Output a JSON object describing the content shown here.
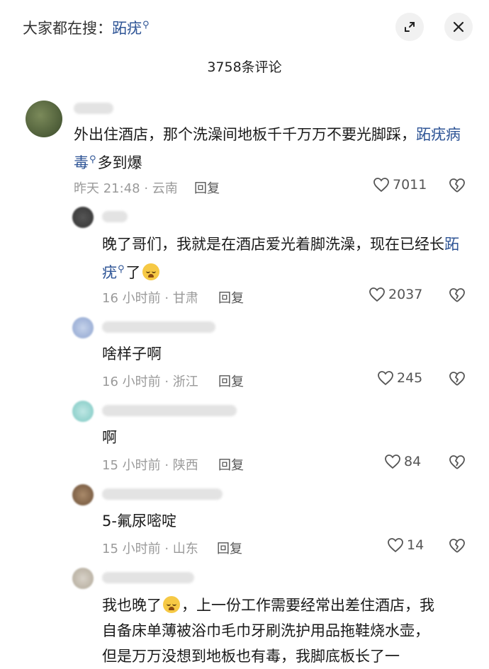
{
  "header": {
    "search_prefix": "大家都在搜：",
    "search_keyword": "跖疣",
    "search_icon": "search-icon",
    "expand_icon": "expand-icon",
    "close_icon": "close-icon"
  },
  "comment_count": "3758条评论",
  "comments": [
    {
      "text_before": "外出住酒店，那个洗澡间地板千千万万不要光脚踩，",
      "keyword": "跖疣病毒",
      "text_after": "多到爆",
      "meta": "昨天 21:48 · 云南",
      "reply": "回复",
      "likes": "7011"
    },
    {
      "text_before": "晚了哥们，我就是在酒店爱光着脚洗澡，现在已经长",
      "keyword": "跖疣",
      "text_after": "了",
      "emoji": "crying-face-emoji",
      "meta": "16 小时前 · 甘肃",
      "reply": "回复",
      "likes": "2037"
    },
    {
      "text": "啥样子啊",
      "meta": "16 小时前 · 浙江",
      "reply": "回复",
      "likes": "245"
    },
    {
      "text": "啊",
      "meta": "15 小时前 · 陕西",
      "reply": "回复",
      "likes": "84"
    },
    {
      "text": "5-氟尿嘧啶",
      "meta": "15 小时前 · 山东",
      "reply": "回复",
      "likes": "14"
    },
    {
      "line1_before": "我也晚了",
      "line1_after": "，上一份工作需要经常出差住酒店，我",
      "line2": "自备床单薄被浴巾毛巾牙刷洗护用品拖鞋烧水壶，",
      "line3": "但是万万没想到地板也有毒，我脚底板长了一"
    }
  ],
  "colors": {
    "keyword": "#2f5596",
    "meta": "#9a9a9a",
    "text": "#1a1a1a"
  }
}
